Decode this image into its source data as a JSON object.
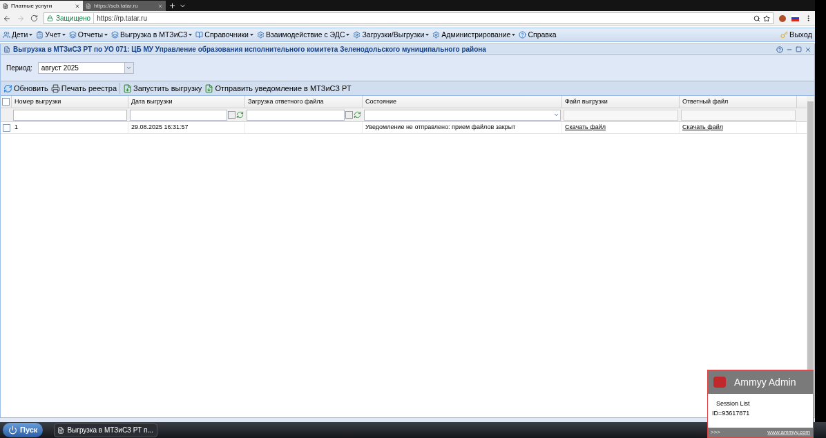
{
  "browser": {
    "tabs": [
      {
        "title": "Платные услуги",
        "selected": true
      },
      {
        "title": "https://scb.tatar.ru",
        "selected": false
      }
    ],
    "secure_label": "Защищено",
    "url": "https://rp.tatar.ru"
  },
  "menu": {
    "items": [
      {
        "label": "Дети",
        "dropdown": true
      },
      {
        "label": "Учет",
        "dropdown": true
      },
      {
        "label": "Отчеты",
        "dropdown": true
      },
      {
        "label": "Выгрузка в МТЗиСЗ",
        "dropdown": true
      },
      {
        "label": "Справочники",
        "dropdown": true
      },
      {
        "label": "Взаимодействие с ЭДС",
        "dropdown": true
      },
      {
        "label": "Загрузки/Выгрузки",
        "dropdown": true
      },
      {
        "label": "Администрирование",
        "dropdown": true
      },
      {
        "label": "Справка",
        "dropdown": false
      }
    ],
    "exit": "Выход"
  },
  "panel": {
    "title": "Выгрузка в МТЗиСЗ РТ по УО 071: ЦБ МУ Управление образования исполнительного комитета Зеленодольского муниципального района",
    "period_label": "Период:",
    "period_value": "август 2025"
  },
  "toolbar": [
    {
      "label": "Обновить",
      "kind": "refresh"
    },
    {
      "label": "Печать реестра",
      "kind": "print"
    },
    {
      "label": "Запустить выгрузку",
      "kind": "file"
    },
    {
      "label": "Отправить уведомление в МТЗиСЗ РТ",
      "kind": "file"
    }
  ],
  "grid": {
    "all_checked": false,
    "columns": [
      {
        "label": "Номер выгрузки",
        "kind": "text"
      },
      {
        "label": "Дата выгрузки",
        "kind": "date"
      },
      {
        "label": "Загрузка ответного файла",
        "kind": "date"
      },
      {
        "label": "Состояние",
        "kind": "select"
      },
      {
        "label": "Файл выгрузки",
        "kind": "readonly"
      },
      {
        "label": "Ответный файл",
        "kind": "readonly"
      }
    ],
    "rows": [
      {
        "checked": false,
        "cells": [
          {
            "text": "1",
            "kind": "text"
          },
          {
            "text": "29.08.2025 16:31:57",
            "kind": "text"
          },
          {
            "kind": "empty"
          },
          {
            "text": "Уведомление не отправлено: прием файлов закрыт",
            "kind": "text"
          },
          {
            "text": "Скачать файл",
            "kind": "link"
          },
          {
            "text": "Скачать файл",
            "kind": "link"
          }
        ]
      }
    ]
  },
  "taskbar": {
    "start": "Пуск",
    "task": "Выгрузка в МТЗиСЗ РТ п..."
  },
  "ammyy": {
    "title": "Ammyy Admin",
    "session_list": "Session List",
    "id": "ID=93617871",
    "more": ">>>",
    "link": "www.ammyy.com"
  }
}
